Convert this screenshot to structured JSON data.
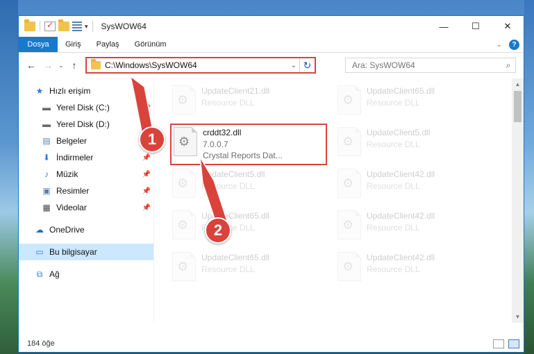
{
  "window": {
    "title": "SysWOW64",
    "controls": {
      "minimize": "—",
      "maximize": "☐",
      "close": "✕"
    }
  },
  "ribbon": {
    "tabs": [
      "Dosya",
      "Giriş",
      "Paylaş",
      "Görünüm"
    ],
    "expand": "⌄",
    "help": "?"
  },
  "address": {
    "path": "C:\\Windows\\SysWOW64",
    "dropdown": "⌄",
    "refresh": "↻"
  },
  "search": {
    "placeholder": "Ara: SysWOW64",
    "icon": "search-icon"
  },
  "nav": {
    "back": "←",
    "forward": "→",
    "recent": "⌄",
    "up": "↑",
    "items": [
      {
        "label": "Hızlı erişim",
        "icon": "star-icon",
        "pinned": false
      },
      {
        "label": "Yerel Disk (C:)",
        "icon": "drive-icon",
        "pinned": true
      },
      {
        "label": "Yerel Disk (D:)",
        "icon": "drive-icon",
        "pinned": true
      },
      {
        "label": "Belgeler",
        "icon": "documents-icon",
        "pinned": true
      },
      {
        "label": "İndirmeler",
        "icon": "download-icon",
        "pinned": true
      },
      {
        "label": "Müzik",
        "icon": "music-icon",
        "pinned": true
      },
      {
        "label": "Resimler",
        "icon": "pictures-icon",
        "pinned": true
      },
      {
        "label": "Videolar",
        "icon": "videos-icon",
        "pinned": true
      },
      {
        "label": "OneDrive",
        "icon": "cloud-icon",
        "pinned": false
      },
      {
        "label": "Bu bilgisayar",
        "icon": "computer-icon",
        "pinned": false
      },
      {
        "label": "Ağ",
        "icon": "network-icon",
        "pinned": false
      }
    ]
  },
  "files": [
    {
      "name": "UpdateClient21.dll",
      "sub1": "Resource DLL",
      "sub2": ""
    },
    {
      "name": "UpdateClient65.dll",
      "sub1": "Resource DLL",
      "sub2": ""
    },
    {
      "name": "crddt32.dll",
      "sub1": "7.0.0.7",
      "sub2": "Crystal Reports Dat..."
    },
    {
      "name": "UpdateClient5.dll",
      "sub1": "Resource DLL",
      "sub2": ""
    },
    {
      "name": "UpdateClient5.dll",
      "sub1": "Resource DLL",
      "sub2": ""
    },
    {
      "name": "UpdateClient42.dll",
      "sub1": "Resource DLL",
      "sub2": ""
    },
    {
      "name": "UpdateClient65.dll",
      "sub1": "Resource DLL",
      "sub2": ""
    },
    {
      "name": "UpdateClient42.dll",
      "sub1": "Resource DLL",
      "sub2": ""
    },
    {
      "name": "UpdateClient65.dll",
      "sub1": "Resource DLL",
      "sub2": ""
    },
    {
      "name": "UpdateClient42.dll",
      "sub1": "Resource DLL",
      "sub2": ""
    }
  ],
  "status": {
    "count": "184 öğe"
  },
  "callouts": [
    "1",
    "2"
  ],
  "colors": {
    "accent": "#1979ca",
    "annotation": "#d9433c",
    "selected": "#cce8ff"
  }
}
